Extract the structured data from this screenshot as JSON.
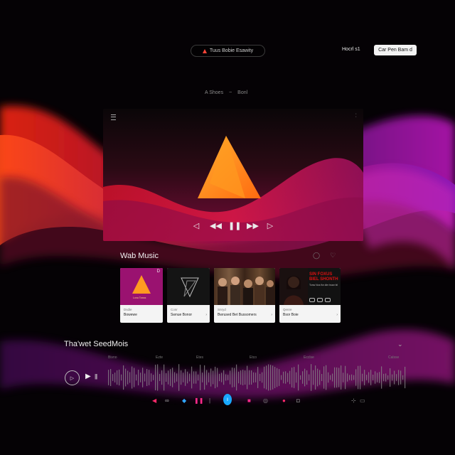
{
  "nav": {
    "pill_label": "Tuus Bobie Esawity",
    "link": "Hocrl s1",
    "cta": "Car Pen Bam d"
  },
  "breadcrumb": {
    "a": "A  Shoes",
    "sep": "~",
    "b": "Bonl"
  },
  "player": {
    "controls": [
      "◁",
      "◀◀",
      "❚❚",
      "▶▶",
      "▷"
    ]
  },
  "section": {
    "title": "Wab Music",
    "cards": [
      {
        "small": "Dsdie",
        "label": "Bowewe",
        "art_caption": "Lona Towss",
        "corner": "D"
      },
      {
        "small": "Conr",
        "label": "Swnue Bonor",
        "corner": ""
      },
      {
        "small": "Snryd",
        "label": "Bwrused Bet Bussomers"
      },
      {
        "small": "Qenre",
        "label": "Bsor Boie",
        "poster_title": "SIN FOXUS BIEL SHONTH",
        "poster_desc": "Tonw Nos fiw dim tnaw bil"
      }
    ]
  },
  "waveform_section": {
    "title": "Tha'wet SeedMois",
    "ticks": [
      "Bivno",
      "Ezte",
      "Etes",
      "Etco",
      "Ecclse",
      "Calsse"
    ]
  },
  "colors": {
    "accent": "#ff8a1c",
    "brand_red": "#ff3a1e",
    "magenta": "#e0208a",
    "purple": "#6a1aa0"
  }
}
